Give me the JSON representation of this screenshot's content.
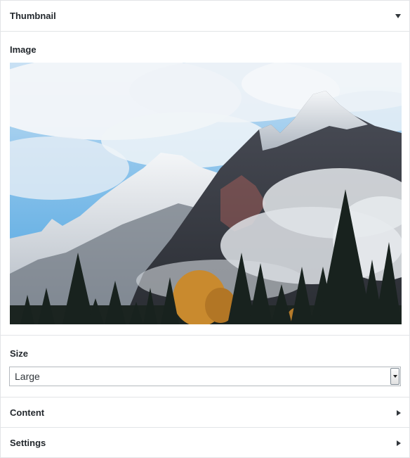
{
  "thumbnail": {
    "title": "Thumbnail",
    "toggle_icon": "chevron-down-icon"
  },
  "image_field": {
    "label": "Image",
    "alt": "Snow-capped mountain peaks above low clouds with evergreen trees and autumn foliage in the foreground"
  },
  "size_field": {
    "label": "Size",
    "selected": "Large",
    "options_icon": "dropdown-arrow-icon"
  },
  "sections": {
    "content": {
      "title": "Content",
      "toggle_icon": "chevron-right-icon"
    },
    "settings": {
      "title": "Settings",
      "toggle_icon": "chevron-right-icon"
    }
  },
  "colors": {
    "border": "#e2e4e7",
    "text": "#23282d",
    "sky": "#5aa9df"
  }
}
